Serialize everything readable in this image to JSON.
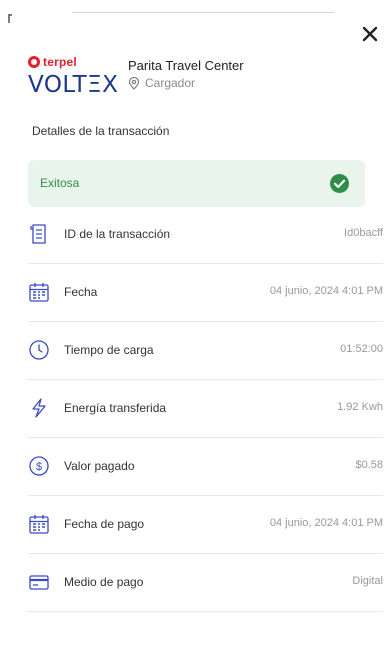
{
  "header": {
    "brand_top": "terpel",
    "brand_bottom": "VOLTΞX",
    "station_name": "Parita Travel Center",
    "station_type": "Cargador"
  },
  "section_title": "Detalles de la transacción",
  "status": {
    "label": "Exitosa",
    "color": "#2f8d4a"
  },
  "details": [
    {
      "icon": "receipt-icon",
      "label": "ID de la transacción",
      "value": "Id0bacff"
    },
    {
      "icon": "calendar-icon",
      "label": "Fecha",
      "value": "04 junio, 2024 4:01 PM"
    },
    {
      "icon": "clock-icon",
      "label": "Tiempo de carga",
      "value": "01:52:00"
    },
    {
      "icon": "lightning-icon",
      "label": "Energía transferida",
      "value": "1.92 Kwh"
    },
    {
      "icon": "dollar-icon",
      "label": "Valor pagado",
      "value": "$0.58"
    },
    {
      "icon": "calendar-icon",
      "label": "Fecha de pago",
      "value": "04 junio, 2024 4:01 PM"
    },
    {
      "icon": "credit-card-icon",
      "label": "Medio de pago",
      "value": "Digital"
    }
  ],
  "colors": {
    "icon_accent": "#3a4bc4",
    "brand_red": "#e5202e",
    "brand_blue": "#1b3a8c",
    "success_bg": "#e9f5ec"
  }
}
